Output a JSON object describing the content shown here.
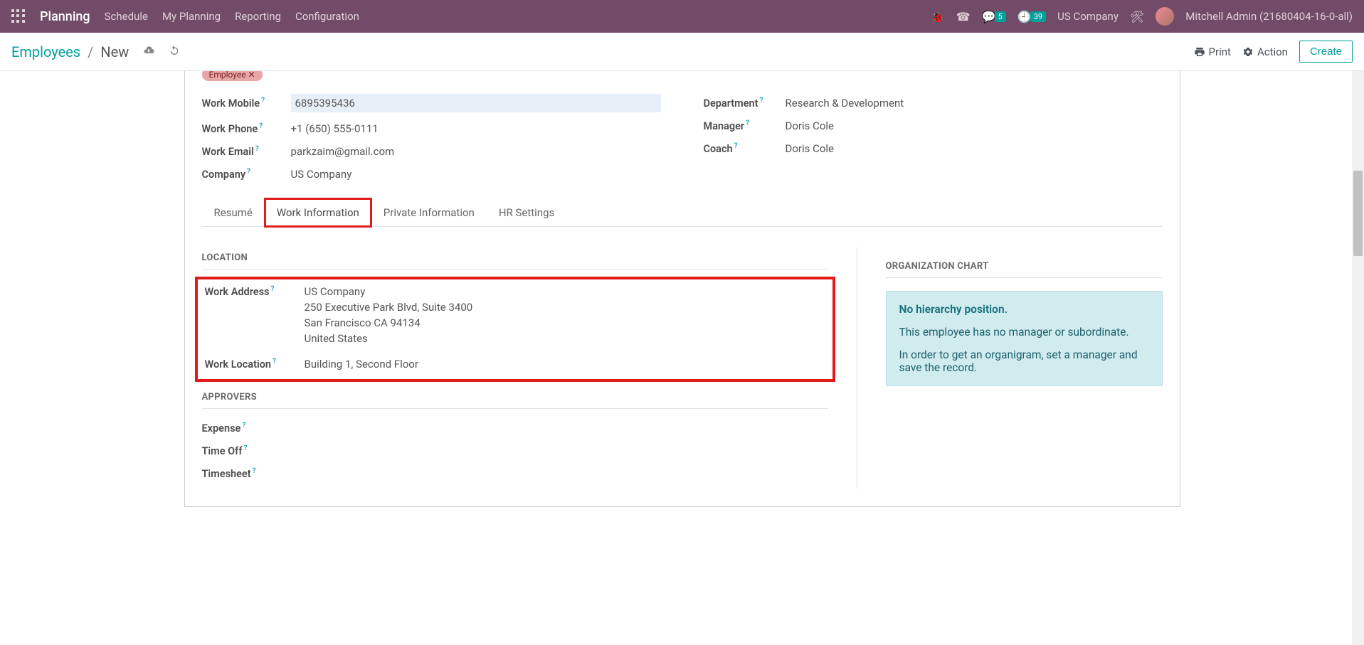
{
  "nav": {
    "brand": "Planning",
    "links": [
      "Schedule",
      "My Planning",
      "Reporting",
      "Configuration"
    ],
    "msg_count": "5",
    "clock_count": "39",
    "company": "US Company",
    "user": "Mitchell Admin (21680404-16-0-all)"
  },
  "breadcrumb": {
    "parent": "Employees",
    "current": "New"
  },
  "cp": {
    "print": "Print",
    "action": "Action",
    "create": "Create"
  },
  "fields": {
    "pill": "Employee ✕",
    "work_mobile_label": "Work Mobile",
    "work_mobile": "6895395436",
    "work_phone_label": "Work Phone",
    "work_phone": "+1 (650) 555-0111",
    "work_email_label": "Work Email",
    "work_email": "parkzaim@gmail.com",
    "company_label": "Company",
    "company": "US Company",
    "department_label": "Department",
    "department": "Research & Development",
    "manager_label": "Manager",
    "manager": "Doris Cole",
    "coach_label": "Coach",
    "coach": "Doris Cole"
  },
  "tabs": {
    "resume": "Resumé",
    "work_info": "Work Information",
    "private_info": "Private Information",
    "hr_settings": "HR Settings"
  },
  "location": {
    "section": "LOCATION",
    "work_address_label": "Work Address",
    "addr_company": "US Company",
    "addr_street": "250 Executive Park Blvd, Suite 3400",
    "addr_city": "San Francisco CA 94134",
    "addr_country": "United States",
    "work_location_label": "Work Location",
    "work_location": "Building 1, Second Floor"
  },
  "approvers": {
    "section": "APPROVERS",
    "expense_label": "Expense",
    "timeoff_label": "Time Off",
    "timesheet_label": "Timesheet"
  },
  "org": {
    "section": "ORGANIZATION CHART",
    "line1": "No hierarchy position.",
    "line2": "This employee has no manager or subordinate.",
    "line3": "In order to get an organigram, set a manager and save the record."
  }
}
